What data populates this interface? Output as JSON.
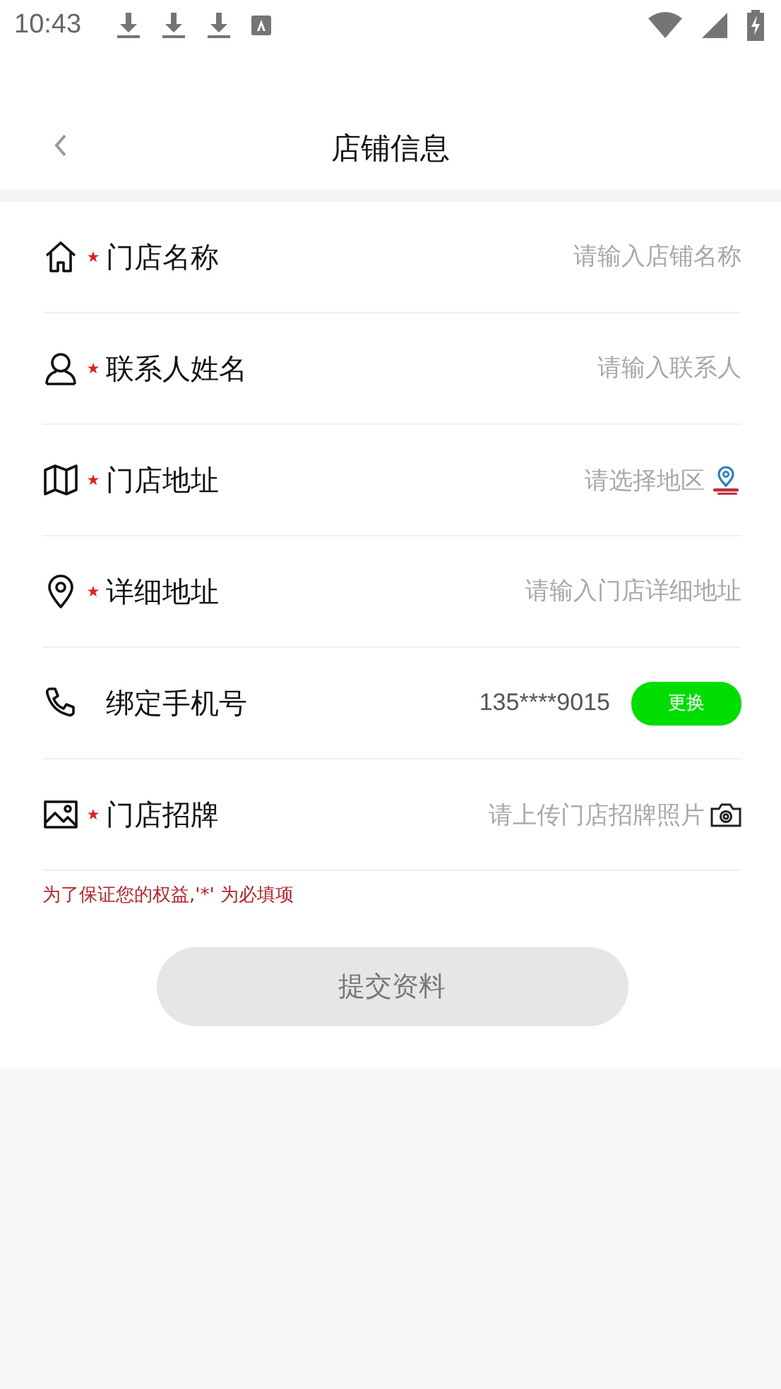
{
  "status_bar": {
    "time": "10:43"
  },
  "header": {
    "title": "店铺信息"
  },
  "rows": [
    {
      "kind": "input",
      "label": "门店名称",
      "required": true,
      "placeholder": "请输入店铺名称"
    },
    {
      "kind": "input",
      "label": "联系人姓名",
      "required": true,
      "placeholder": "请输入联系人"
    },
    {
      "kind": "select",
      "label": "门店地址",
      "required": true,
      "placeholder": "请选择地区"
    },
    {
      "kind": "input",
      "label": "详细地址",
      "required": true,
      "placeholder": "请输入门店详细地址"
    },
    {
      "kind": "phone",
      "label": "绑定手机号",
      "required": false,
      "value": "135****9015",
      "button": "更换"
    },
    {
      "kind": "upload",
      "label": "门店招牌",
      "required": true,
      "placeholder": "请上传门店招牌照片"
    }
  ],
  "note": "为了保证您的权益,'*' 为必填项",
  "submit": {
    "label": "提交资料",
    "disabled": true
  }
}
